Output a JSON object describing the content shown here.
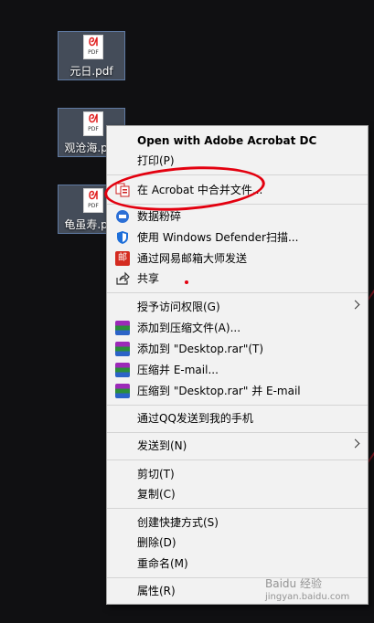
{
  "desktop": {
    "files": [
      {
        "name": "元日.pdf",
        "type_tag": "PDF"
      },
      {
        "name": "观沧海.pdf",
        "type_tag": "PDF"
      },
      {
        "name": "龟虽寿.pdf",
        "type_tag": "PDF"
      }
    ]
  },
  "context_menu": {
    "items": [
      {
        "label": "Open with Adobe Acrobat DC",
        "bold": true
      },
      {
        "label": "打印(P)"
      },
      {
        "label": "在 Acrobat 中合并文件...",
        "icon": "acrobat-combine-icon"
      },
      {
        "label": "数据粉碎",
        "icon": "shred-icon"
      },
      {
        "label": "使用 Windows Defender扫描...",
        "icon": "defender-shield-icon"
      },
      {
        "label": "通过网易邮箱大师发送",
        "icon": "netease-mail-icon",
        "icon_text": "邮"
      },
      {
        "label": "共享",
        "icon": "share-icon"
      },
      {
        "label": "授予访问权限(G)",
        "submenu": true
      },
      {
        "label": "添加到压缩文件(A)...",
        "icon": "winrar-icon"
      },
      {
        "label": "添加到 \"Desktop.rar\"(T)",
        "icon": "winrar-icon"
      },
      {
        "label": "压缩并 E-mail...",
        "icon": "winrar-icon"
      },
      {
        "label": "压缩到 \"Desktop.rar\" 并 E-mail",
        "icon": "winrar-icon"
      },
      {
        "label": "通过QQ发送到我的手机"
      },
      {
        "label": "发送到(N)",
        "submenu": true
      },
      {
        "label": "剪切(T)"
      },
      {
        "label": "复制(C)"
      },
      {
        "label": "创建快捷方式(S)"
      },
      {
        "label": "删除(D)"
      },
      {
        "label": "重命名(M)"
      },
      {
        "label": "属性(R)"
      }
    ]
  },
  "watermark": {
    "brand": "Baidu 经验",
    "url": "jingyan.baidu.com"
  },
  "colors": {
    "annotation": "#e3000f",
    "menu_bg": "#f2f2f2",
    "selection": "#5f7aa2"
  }
}
